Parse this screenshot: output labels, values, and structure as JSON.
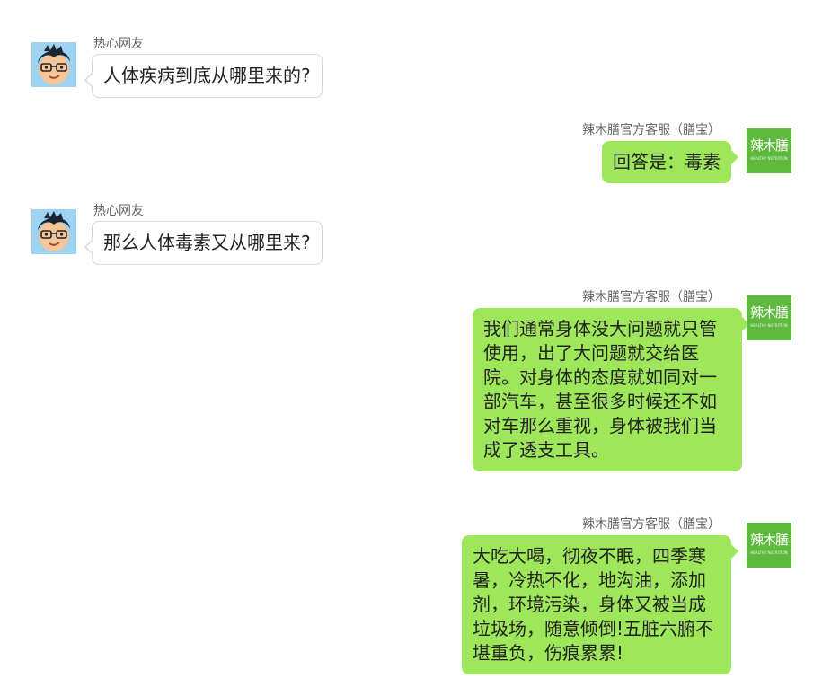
{
  "colors": {
    "incoming_bubble": "#ffffff",
    "outgoing_bubble": "#9fe75a",
    "brand_avatar": "#5dba3e",
    "user_avatar_bg": "#9fd3f2"
  },
  "brand_avatar": {
    "title": "辣木膳",
    "subtitle": "HEALTHY NUTRITION"
  },
  "messages": [
    {
      "side": "left",
      "sender": "热心网友",
      "avatar": "cartoon-boy-avatar",
      "text": "人体疾病到底从哪里来的?"
    },
    {
      "side": "right",
      "sender": "辣木膳官方客服（膳宝）",
      "avatar": "brand-logo-avatar",
      "text": "回答是：毒素"
    },
    {
      "side": "left",
      "sender": "热心网友",
      "avatar": "cartoon-boy-avatar",
      "text": "那么人体毒素又从哪里来?"
    },
    {
      "side": "right",
      "sender": "辣木膳官方客服（膳宝）",
      "avatar": "brand-logo-avatar",
      "text": "我们通常身体没大问题就只管使用，出了大问题就交给医院。对身体的态度就如同对一部汽车，甚至很多时候还不如对车那么重视，身体被我们当成了透支工具。"
    },
    {
      "side": "right",
      "sender": "辣木膳官方客服（膳宝）",
      "avatar": "brand-logo-avatar",
      "text": "大吃大喝，彻夜不眠，四季寒暑，冷热不化，地沟油，添加剂，环境污染，身体又被当成垃圾场，随意倾倒!五脏六腑不堪重负，伤痕累累!"
    }
  ]
}
